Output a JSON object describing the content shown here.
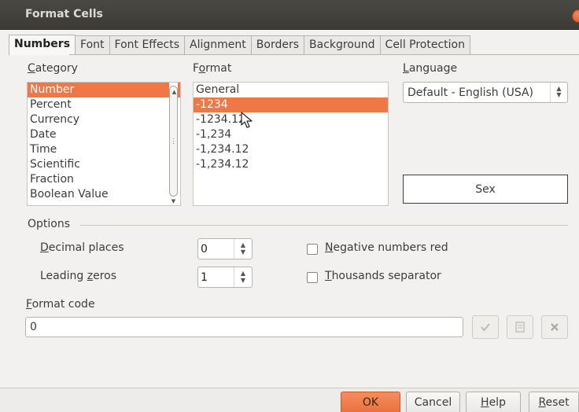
{
  "window": {
    "title": "Format Cells"
  },
  "tabs": [
    {
      "label": "Numbers",
      "active": true
    },
    {
      "label": "Font"
    },
    {
      "label": "Font Effects"
    },
    {
      "label": "Alignment"
    },
    {
      "label": "Borders"
    },
    {
      "label": "Background"
    },
    {
      "label": "Cell Protection"
    }
  ],
  "category": {
    "label_pre": "",
    "label_mnemonic": "C",
    "label_post": "ategory",
    "items": [
      "Number",
      "Percent",
      "Currency",
      "Date",
      "Time",
      "Scientific",
      "Fraction",
      "Boolean Value"
    ],
    "selected": "Number"
  },
  "format": {
    "label_pre": "F",
    "label_mnemonic": "o",
    "label_post": "rmat",
    "items": [
      "General",
      "-1234",
      "-1234.12",
      "-1,234",
      "-1,234.12",
      "-1,234.12"
    ],
    "selected": "-1234"
  },
  "language": {
    "label_pre": "",
    "label_mnemonic": "L",
    "label_post": "anguage",
    "value": "Default - English (USA)"
  },
  "preview": {
    "text": "Sex"
  },
  "options": {
    "heading": "Options",
    "decimal_places": {
      "label_pre": "",
      "label_mnemonic": "D",
      "label_post": "ecimal places",
      "value": "0"
    },
    "leading_zeros": {
      "label_pre": "Leading ",
      "label_mnemonic": "z",
      "label_post": "eros",
      "value": "1"
    },
    "negative_red": {
      "label_pre": "",
      "label_mnemonic": "N",
      "label_post": "egative numbers red",
      "checked": false
    },
    "thousands_sep": {
      "label_pre": "",
      "label_mnemonic": "T",
      "label_post": "housands separator",
      "checked": false
    }
  },
  "format_code": {
    "label_pre": "",
    "label_mnemonic": "F",
    "label_post": "ormat code",
    "value": "0"
  },
  "buttons": {
    "ok": "OK",
    "cancel": "Cancel",
    "help_pre": "",
    "help_mnemonic": "H",
    "help_post": "elp",
    "reset_pre": "",
    "reset_mnemonic": "R",
    "reset_post": "eset"
  },
  "icons": {
    "add": "checkmark-icon",
    "edit_comment": "comment-icon",
    "delete": "delete-x-icon"
  },
  "colors": {
    "accent": "#f07746",
    "titlebar": "#3b3a36"
  }
}
